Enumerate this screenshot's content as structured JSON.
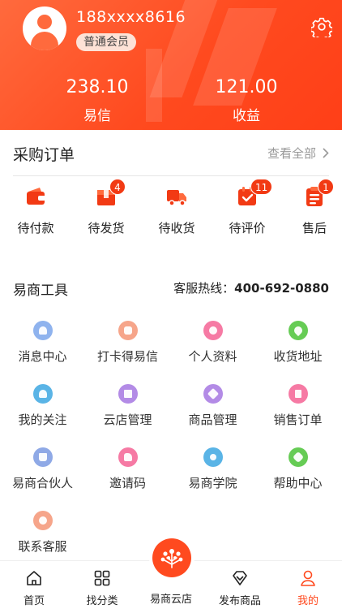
{
  "profile": {
    "phone": "188xxxx8616",
    "member_level": "普通会员",
    "avatar_icon": "user-avatar-icon",
    "settings_icon": "gear-icon"
  },
  "stats": [
    {
      "value": "238.10",
      "label": "易信"
    },
    {
      "value": "121.00",
      "label": "收益"
    }
  ],
  "orders": {
    "title": "采购订单",
    "view_all": "查看全部",
    "items": [
      {
        "label": "待付款",
        "icon": "wallet-icon",
        "badge": ""
      },
      {
        "label": "待发货",
        "icon": "package-icon",
        "badge": "4"
      },
      {
        "label": "待收货",
        "icon": "truck-icon",
        "badge": ""
      },
      {
        "label": "待评价",
        "icon": "review-check-icon",
        "badge": "11"
      },
      {
        "label": "售后",
        "icon": "after-sale-icon",
        "badge": "1"
      }
    ]
  },
  "tools": {
    "title": "易商工具",
    "hotline_label": "客服热线：",
    "hotline_number": "400-692-0880",
    "items": [
      {
        "label": "消息中心",
        "icon": "bell-icon",
        "color": "#8fb3ee"
      },
      {
        "label": "打卡得易信",
        "icon": "gift-icon",
        "color": "#f6a58a"
      },
      {
        "label": "个人资料",
        "icon": "profile-icon",
        "color": "#f67aa4"
      },
      {
        "label": "收货地址",
        "icon": "location-icon",
        "color": "#66cc55"
      },
      {
        "label": "我的关注",
        "icon": "heart-icon",
        "color": "#5ab4e6"
      },
      {
        "label": "云店管理",
        "icon": "store-icon",
        "color": "#b38be6"
      },
      {
        "label": "商品管理",
        "icon": "box-icon",
        "color": "#b38be6"
      },
      {
        "label": "销售订单",
        "icon": "document-icon",
        "color": "#f67aa4"
      },
      {
        "label": "易商合伙人",
        "icon": "crown-icon",
        "color": "#8fa9e6"
      },
      {
        "label": "邀请码",
        "icon": "thumbs-up-icon",
        "color": "#f67aa4"
      },
      {
        "label": "易商学院",
        "icon": "compass-icon",
        "color": "#5ab4e6"
      },
      {
        "label": "帮助中心",
        "icon": "tag-icon",
        "color": "#66cc55"
      },
      {
        "label": "联系客服",
        "icon": "chat-icon",
        "color": "#f6a58a"
      }
    ]
  },
  "tabbar": {
    "items": [
      {
        "label": "首页",
        "icon": "home-icon"
      },
      {
        "label": "找分类",
        "icon": "grid-icon"
      },
      {
        "label": "易商云店",
        "icon": "tree-logo-icon"
      },
      {
        "label": "发布商品",
        "icon": "diamond-icon"
      },
      {
        "label": "我的",
        "icon": "person-icon",
        "active": true
      }
    ]
  },
  "colors": {
    "brand": "#ff4a1f",
    "badge": "#f23a14"
  }
}
